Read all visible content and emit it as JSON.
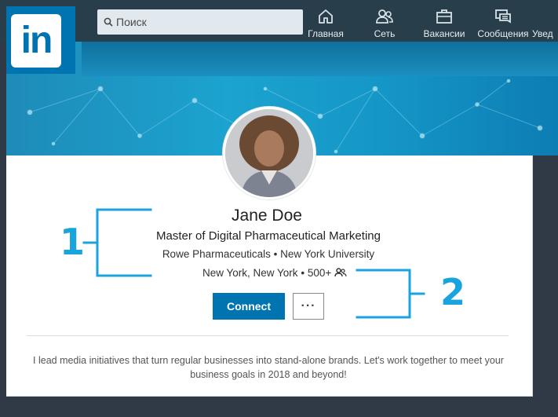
{
  "app": {
    "logo_text": "in",
    "brand_color": "#0073b1"
  },
  "search": {
    "placeholder": "Поиск",
    "icon": "search-icon"
  },
  "nav": [
    {
      "label": "Главная",
      "icon": "home-icon"
    },
    {
      "label": "Сеть",
      "icon": "network-icon"
    },
    {
      "label": "Вакансии",
      "icon": "jobs-icon"
    },
    {
      "label": "Сообщения",
      "icon": "messaging-icon"
    },
    {
      "label": "Увед",
      "icon": "notifications-icon"
    }
  ],
  "profile": {
    "name": "Jane Doe",
    "headline": "Master of Digital Pharmaceutical Marketing",
    "company": "Rowe Pharmaceuticals",
    "school": "New York University",
    "separator": "•",
    "location": "New York, New York",
    "connections": "500+",
    "connections_icon": "people-icon",
    "connect_label": "Connect",
    "more_label": "···",
    "summary": "I lead media initiatives that turn regular businesses into stand-alone brands. Let's work together to meet your business goals in 2018 and beyond!"
  },
  "annotations": {
    "first": "1",
    "second": "2",
    "color": "#1aa4dd"
  }
}
